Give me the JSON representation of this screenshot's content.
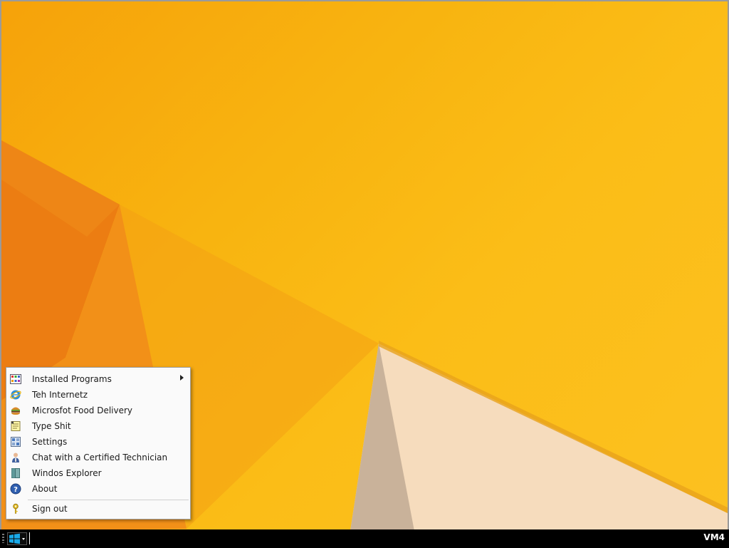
{
  "start_menu": {
    "items": [
      {
        "label": "Installed Programs",
        "icon": "programs-icon",
        "has_submenu": true
      },
      {
        "label": "Teh Internetz",
        "icon": "internet-explorer-icon"
      },
      {
        "label": "Microsfot Food Delivery",
        "icon": "burger-icon"
      },
      {
        "label": "Type Shit",
        "icon": "notepad-icon"
      },
      {
        "label": "Settings",
        "icon": "settings-icon"
      },
      {
        "label": "Chat with a Certified Technician",
        "icon": "technician-icon"
      },
      {
        "label": "Windos Explorer",
        "icon": "explorer-icon"
      },
      {
        "label": "About",
        "icon": "help-icon"
      }
    ],
    "sign_out": {
      "label": "Sign out",
      "icon": "key-icon"
    }
  },
  "taskbar": {
    "vm_label": "VM4"
  },
  "colors": {
    "wallpaper": "#f8b410",
    "taskbar": "#000000",
    "windows_logo": "#19a9e8"
  }
}
